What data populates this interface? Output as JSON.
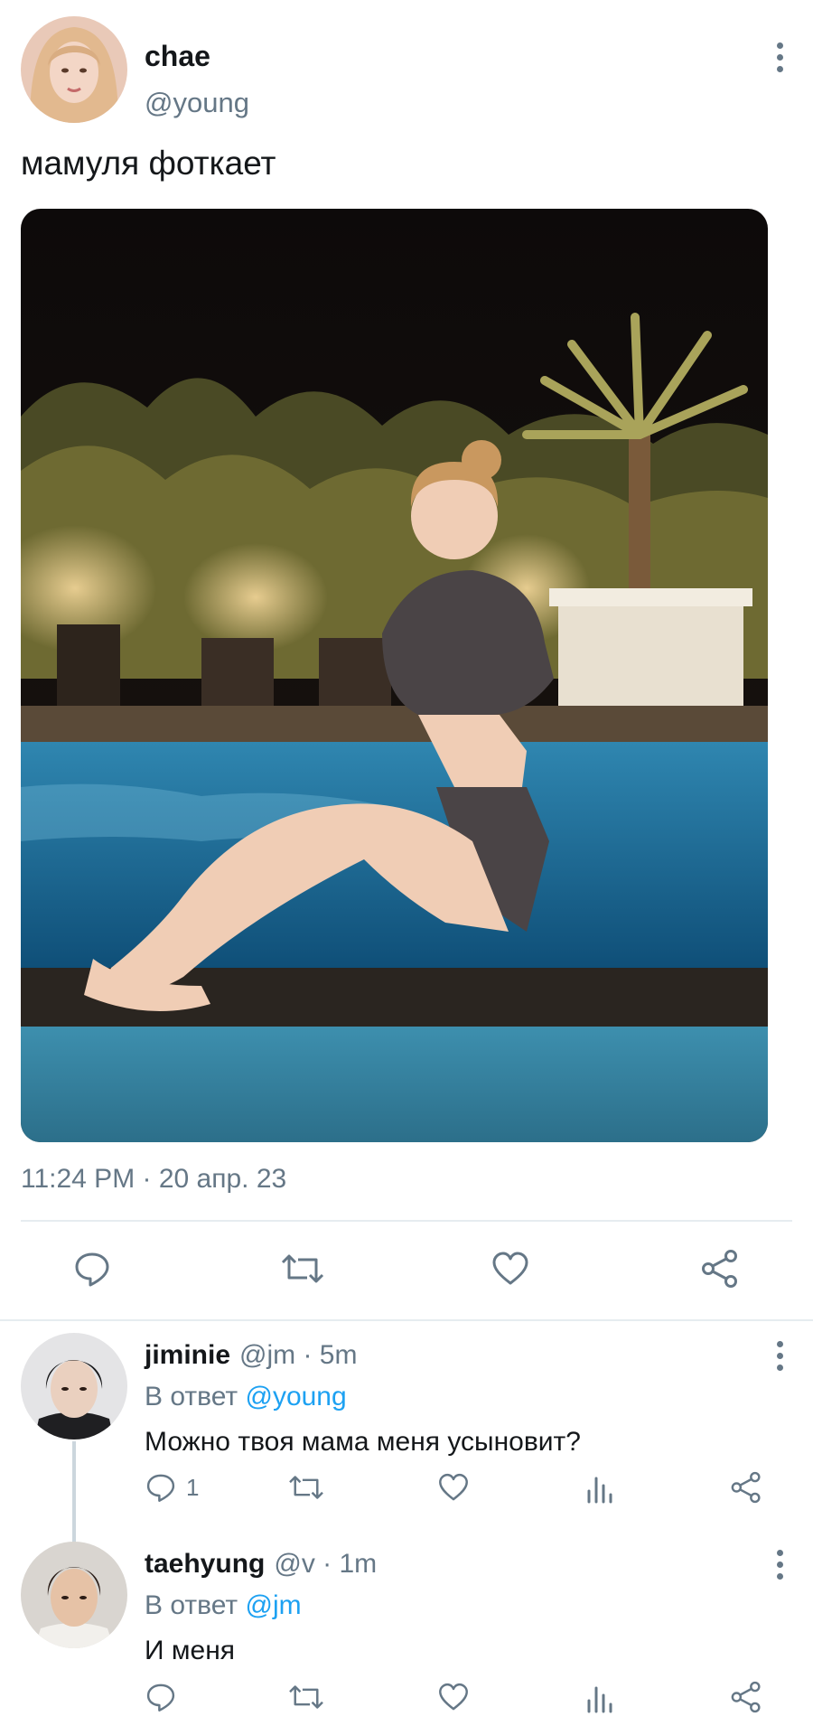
{
  "tweet": {
    "display_name": "chae",
    "handle": "@young",
    "text": "мамуля фоткает",
    "timestamp": "11:24 PM · 20 апр. 23",
    "actions": [
      "reply-icon",
      "retweet-icon",
      "like-icon",
      "share-icon"
    ]
  },
  "replies": [
    {
      "display_name": "jiminie",
      "meta": "@jm · 5m",
      "reply_prefix": "В ответ",
      "reply_to": "@young",
      "text": "Можно твоя мама меня усыновит?",
      "reply_count": "1"
    },
    {
      "display_name": "taehyung",
      "meta": "@v · 1m",
      "reply_prefix": "В ответ",
      "reply_to": "@jm",
      "text": "И меня",
      "reply_count": ""
    }
  ],
  "colors": {
    "text": "#14171a",
    "secondary": "#657786",
    "link": "#1da1f2",
    "divider": "#e6ecf0"
  }
}
